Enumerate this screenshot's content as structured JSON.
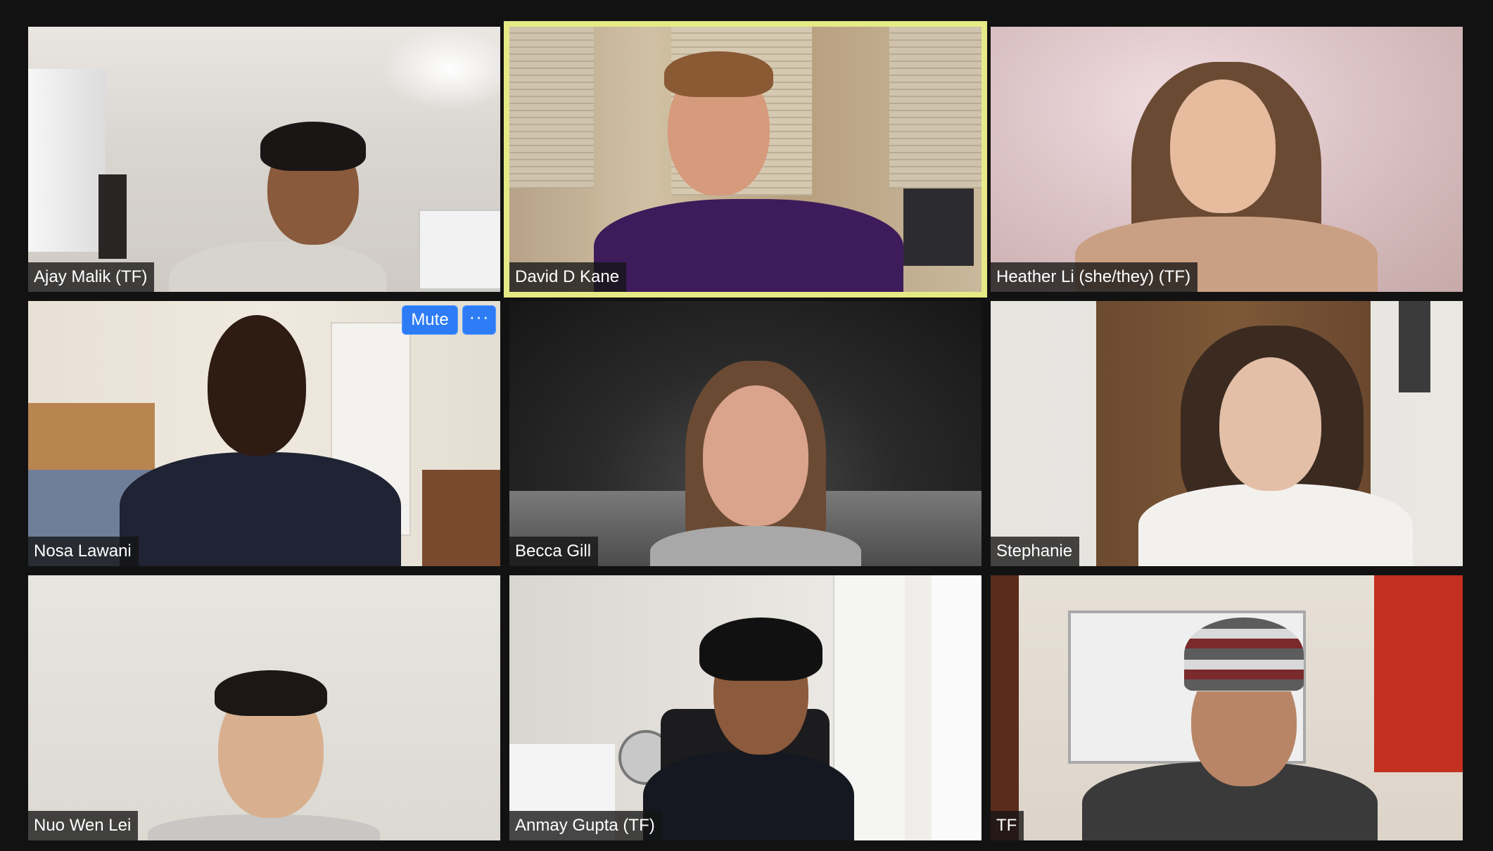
{
  "meeting": {
    "view": "gallery",
    "active_speaker_color": "#e5ea86",
    "accent_button_color": "#2d7cf6"
  },
  "participants": [
    {
      "name": "Ajay Malik (TF)"
    },
    {
      "name": "David D Kane"
    },
    {
      "name": "Heather Li (she/they) (TF)"
    },
    {
      "name": "Nosa Lawani"
    },
    {
      "name": "Becca Gill"
    },
    {
      "name": "Stephanie"
    },
    {
      "name": "Nuo Wen Lei"
    },
    {
      "name": "Anmay Gupta (TF)"
    },
    {
      "name": "TF"
    }
  ],
  "hover_controls": {
    "mute_label": "Mute",
    "more_label": "···",
    "more_icon": "ellipsis-icon"
  }
}
